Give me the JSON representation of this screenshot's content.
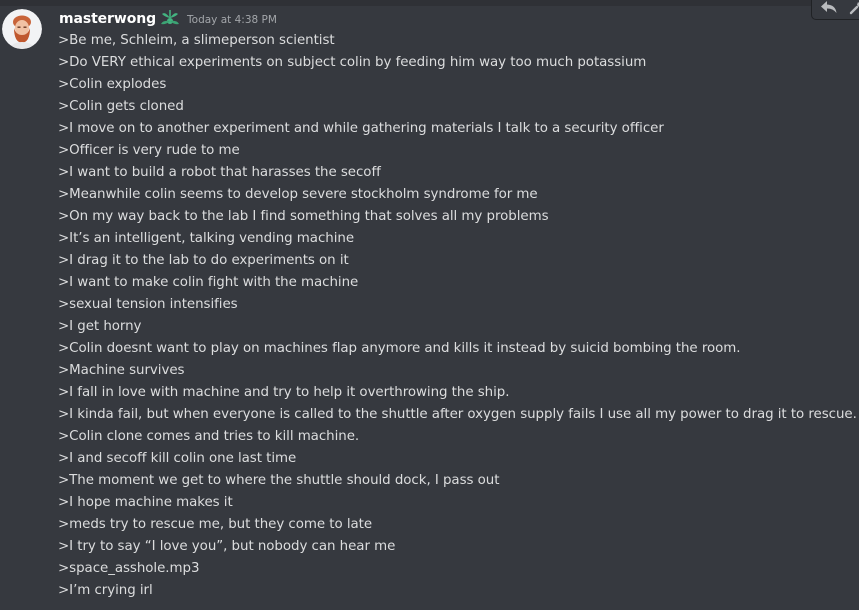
{
  "message": {
    "author": "masterwong",
    "timestamp": "Today at 4:38 PM",
    "role_icon": "leaf-badge-icon",
    "author_color": "#ffffff",
    "role_icon_color": "#43b581",
    "lines": [
      ">Be me, Schleim, a slimeperson scientist",
      ">Do VERY ethical experiments on subject colin by feeding him way too much potassium",
      ">Colin explodes",
      ">Colin gets cloned",
      ">I move on to another experiment and while gathering materials I talk to a security officer",
      ">Officer is very rude to me",
      ">I want to build a robot that harasses the secoff",
      ">Meanwhile colin seems to develop severe stockholm syndrome for me",
      ">On my way back to the lab I find something that solves all my problems",
      ">It’s an intelligent, talking vending machine",
      ">I drag it to the lab to do experiments on it",
      ">I want to make colin fight with the machine",
      ">sexual tension intensifies",
      ">I get horny",
      ">Colin doesnt want to play on machines flap anymore and kills it instead by suicid bombing the room.",
      ">Machine survives",
      ">I fall in love with machine and try to help it overthrowing the ship.",
      ">I kinda fail, but when everyone is called to the shuttle after oxygen supply fails I use all my power to drag it to rescue.",
      ">Colin clone comes and tries to kill machine.",
      ">I and secoff kill colin one last time",
      ">The moment we get to where the shuttle should dock, I pass out",
      ">I hope machine makes it",
      ">meds try to rescue me, but they come to late",
      ">I try to say “I love you”, but nobody can hear me",
      ">space_asshole.mp3",
      ">I’m crying irl"
    ]
  },
  "toolbar": {
    "reply_icon": "reply-arrow-icon",
    "more_icon": "more-actions-icon"
  },
  "colors": {
    "background": "#36393f",
    "text": "#dcddde",
    "muted": "#a3a6aa"
  }
}
